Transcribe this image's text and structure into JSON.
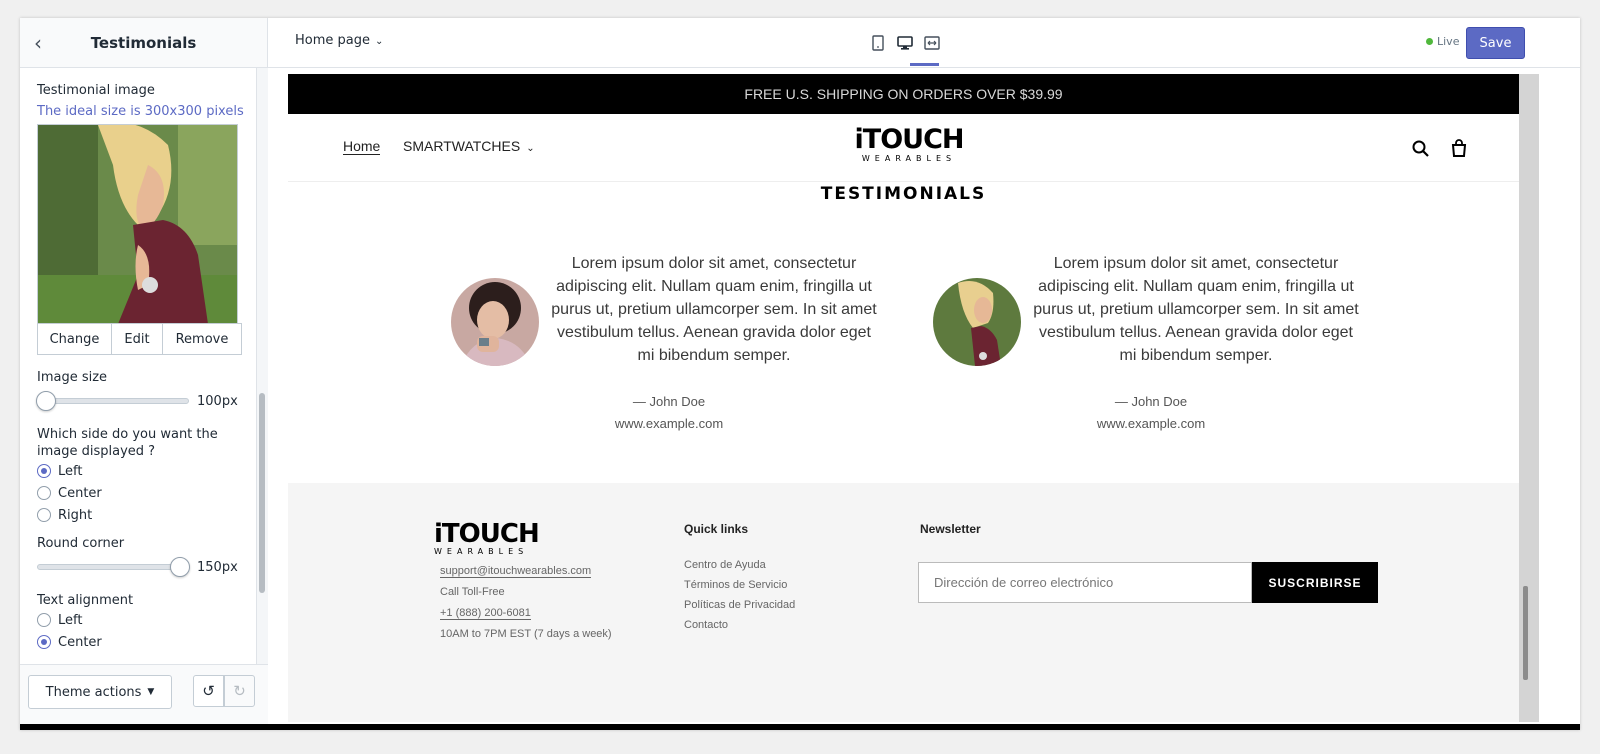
{
  "sidebar": {
    "title": "Testimonials",
    "image_label": "Testimonial image",
    "image_hint": "The ideal size is 300x300 pixels",
    "buttons": {
      "change": "Change",
      "edit": "Edit",
      "remove": "Remove"
    },
    "image_size": {
      "label": "Image size",
      "value": "100px"
    },
    "side": {
      "label": "Which side do you want the image displayed ?",
      "options": [
        "Left",
        "Center",
        "Right"
      ],
      "selected": "Left"
    },
    "round_corner": {
      "label": "Round corner",
      "value": "150px"
    },
    "text_alignment": {
      "label": "Text alignment",
      "options": [
        "Left",
        "Center"
      ],
      "selected": "Center"
    },
    "theme_actions": "Theme actions"
  },
  "topbar": {
    "page": "Home page",
    "live": "Live",
    "save": "Save"
  },
  "preview": {
    "announcement": "FREE U.S. SHIPPING ON ORDERS OVER $39.99",
    "nav": {
      "home": "Home",
      "smartwatches": "SMARTWATCHES"
    },
    "logo": {
      "main": "iTOUCH",
      "sub": "WEARABLES"
    },
    "section_title": "TESTIMONIALS",
    "testimonials": [
      {
        "quote": "Lorem ipsum dolor sit amet, consectetur adipiscing elit. Nullam quam enim, fringilla ut purus ut, pretium ullamcorper sem. In sit amet vestibulum tellus. Aenean gravida dolor eget mi bibendum semper.",
        "author": "— John Doe",
        "site": "www.example.com"
      },
      {
        "quote": "Lorem ipsum dolor sit amet, consectetur adipiscing elit. Nullam quam enim, fringilla ut purus ut, pretium ullamcorper sem. In sit amet vestibulum tellus. Aenean gravida dolor eget mi bibendum semper.",
        "author": "— John Doe",
        "site": "www.example.com"
      }
    ],
    "footer": {
      "email": "support@itouchwearables.com",
      "call": "Call Toll-Free",
      "phone": "+1 (888) 200-6081",
      "hours": "10AM to 7PM EST (7 days a week)",
      "quick_links_title": "Quick links",
      "quick_links": [
        "Centro de Ayuda",
        "Términos de Servicio",
        "Políticas de Privacidad",
        "Contacto"
      ],
      "newsletter_title": "Newsletter",
      "newsletter_placeholder": "Dirección de correo electrónico",
      "newsletter_button": "SUSCRIBIRSE"
    }
  },
  "colors": {
    "accent": "#5c6ac4",
    "live": "#50b83c",
    "announcement_bg": "#000000"
  }
}
